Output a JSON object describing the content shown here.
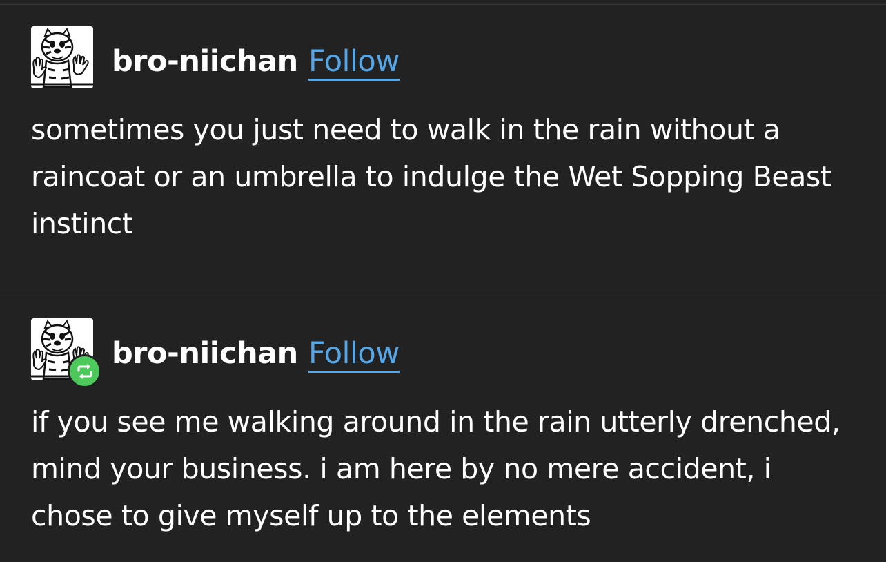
{
  "posts": [
    {
      "username": "bro-niichan",
      "follow_label": "Follow",
      "reblogged": false,
      "body": "sometimes you just need to walk in the rain without a raincoat or an umbrella to indulge the Wet Sopping Beast instinct"
    },
    {
      "username": "bro-niichan",
      "follow_label": "Follow",
      "reblogged": true,
      "body": "if you see me walking around in the rain utterly drenched, mind your business. i am here by no mere accident, i chose to give myself up to the elements"
    }
  ],
  "colors": {
    "background": "#222222",
    "text": "#ffffff",
    "link": "#56a7e8",
    "reblog_badge": "#4dc85a",
    "divider": "#3d3d3d"
  },
  "icons": {
    "avatar": "tiger-cartoon-avatar",
    "reblog": "reblog-icon"
  }
}
